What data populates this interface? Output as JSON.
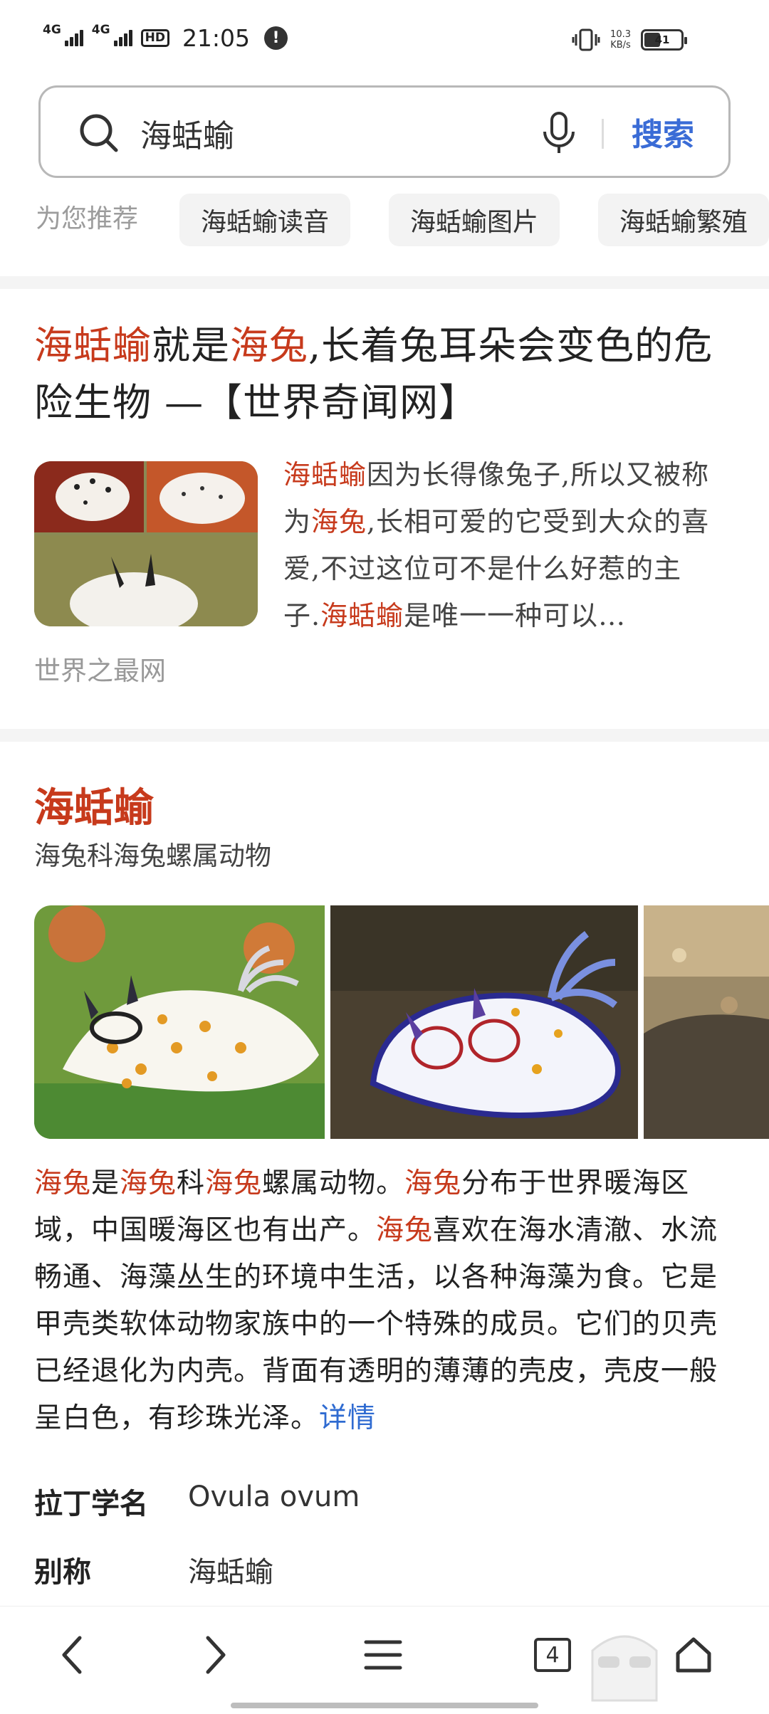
{
  "status_bar": {
    "net1": "4G",
    "net2": "4G",
    "hd": "HD",
    "time": "21:05",
    "alert": "!",
    "speed_value": "10.3",
    "speed_unit": "KB/s",
    "battery": "41"
  },
  "search": {
    "query": "海蛞蝓",
    "button_label": "搜索"
  },
  "recommend": {
    "label": "为您推荐",
    "chips": [
      "海蛞蝓读音",
      "海蛞蝓图片",
      "海蛞蝓繁殖"
    ]
  },
  "result1": {
    "title": [
      "海蛞蝓",
      "就是",
      "海兔",
      ",长着兔耳朵会变色的危险生物 —【世界奇闻网】"
    ],
    "snippet": [
      "海蛞蝓",
      "因为长得像兔子,所以又被称为",
      "海兔",
      ",长相可爱的它受到大众的喜爱,不过这位可不是什么好惹的主子.",
      "海蛞蝓",
      "是唯一一种可以…"
    ],
    "source": "世界之最网"
  },
  "result2": {
    "title": "海蛞蝓",
    "subtitle": "海兔科海兔螺属动物",
    "body": [
      "海兔",
      "是",
      "海兔",
      "科",
      "海兔",
      "螺属动物。",
      "海兔",
      "分布于世界暖海区域，中国暖海区也有出产。",
      "海兔",
      "喜欢在海水清澈、水流畅通、海藻丛生的环境中生活，以各种海藻为食。它是甲壳类软体动物家族中的一个特殊的成员。它们的贝壳已经退化为内壳。背面有透明的薄薄的壳皮，壳皮一般呈白色，有珍珠光泽。"
    ],
    "more_label": "详情",
    "info": [
      {
        "key": "拉丁学名",
        "value": "Ovula ovum"
      },
      {
        "key": "别称",
        "value": "海蛞蝓"
      }
    ]
  },
  "bottom_nav": {
    "tabs_count": "4"
  },
  "colors": {
    "highlight": "#c73a1c",
    "link": "#2f6bd1",
    "search_button": "#3a6cd6"
  }
}
